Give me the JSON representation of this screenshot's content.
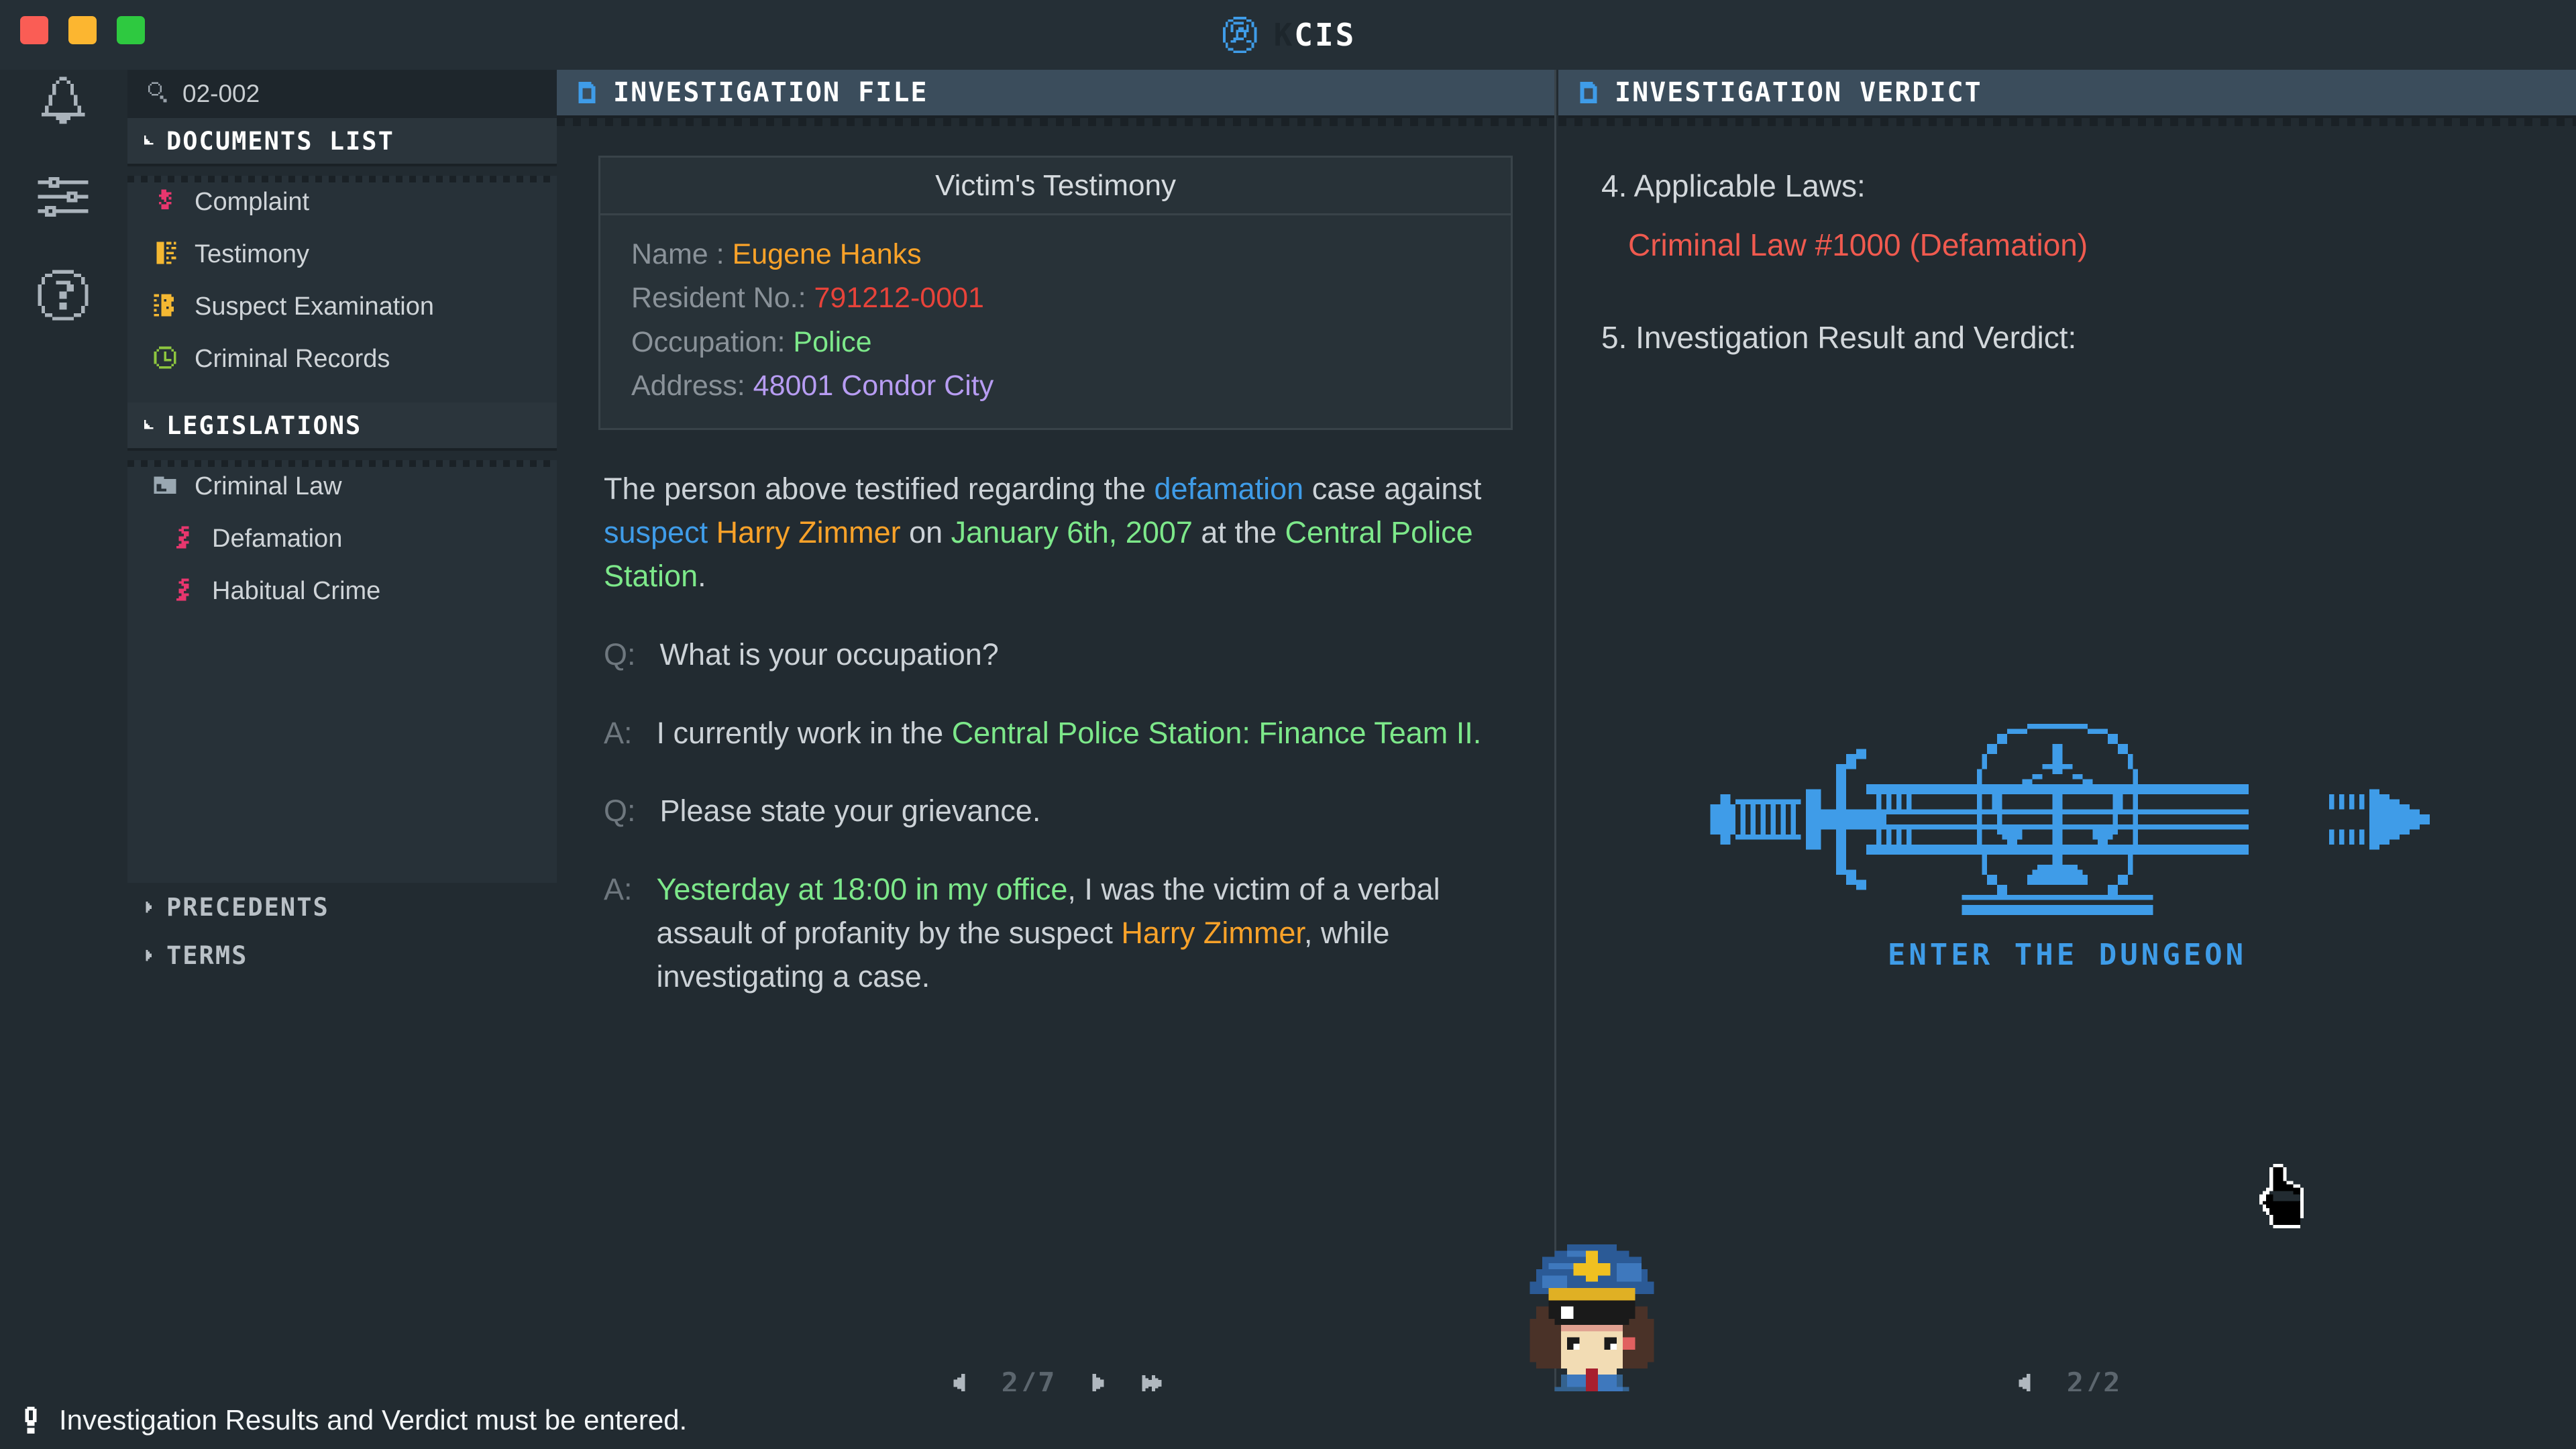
{
  "window": {
    "title": "KCIS",
    "title_prefix": "K",
    "title_rest": "CIS",
    "controls": [
      "close",
      "minimize",
      "maximize"
    ]
  },
  "rail": {
    "items": [
      {
        "name": "notifications",
        "icon": "bell-icon"
      },
      {
        "name": "settings",
        "icon": "sliders-icon"
      },
      {
        "name": "help",
        "icon": "question-circle-icon"
      }
    ]
  },
  "sidebar": {
    "search": {
      "value": "02-002",
      "placeholder": "Search",
      "icon": "search-icon"
    },
    "sections": [
      {
        "label": "DOCUMENTS LIST",
        "expanded": true,
        "items": [
          {
            "label": "Complaint",
            "icon": "complaint-icon",
            "color": "#e8366e"
          },
          {
            "label": "Testimony",
            "icon": "testimony-icon",
            "color": "#f4b832"
          },
          {
            "label": "Suspect Examination",
            "icon": "suspect-icon",
            "color": "#f4b832"
          },
          {
            "label": "Criminal Records",
            "icon": "records-icon",
            "color": "#8ec63f"
          }
        ]
      },
      {
        "label": "LEGISLATIONS",
        "expanded": true,
        "items": [
          {
            "label": "Criminal Law",
            "icon": "folder-icon",
            "color": "#9aa8b2",
            "sub": false
          },
          {
            "label": "Defamation",
            "icon": "section-sign-icon",
            "color": "#e8366e",
            "sub": true
          },
          {
            "label": "Habitual Crime",
            "icon": "section-sign-icon",
            "color": "#e8366e",
            "sub": true
          }
        ]
      },
      {
        "label": "PRECEDENTS",
        "expanded": false,
        "items": []
      },
      {
        "label": "TERMS",
        "expanded": false,
        "items": []
      }
    ]
  },
  "center_panel": {
    "header": {
      "title": "INVESTIGATION FILE",
      "icon": "document-icon"
    },
    "card": {
      "title": "Victim's Testimony",
      "fields": [
        {
          "label": "Name :",
          "value": "Eugene Hanks",
          "value_color": "#f9a229"
        },
        {
          "label": "Resident No.:",
          "value": "791212-0001",
          "value_color": "#e8433a"
        },
        {
          "label": "Occupation:",
          "value": "Police",
          "value_color": "#7de88a"
        },
        {
          "label": "Address:",
          "value": "48001 Condor City",
          "value_color": "#b79cf2"
        }
      ]
    },
    "narrative": {
      "p1": "The person above testified regarding the ",
      "h_defamation": "defamation",
      "p2": " case against ",
      "h_suspect": "suspect",
      "p3": " ",
      "h_harry": "Harry Zimmer",
      "p4": " on ",
      "h_date": "January 6th, 2007",
      "p5": " at the ",
      "h_place": "Central Police Station",
      "p6": "."
    },
    "qa": [
      {
        "label": "Q:",
        "p1": "What is your occupation?"
      },
      {
        "label": "A:",
        "p1": "I currently work in the ",
        "h1": "Central Police Station: Finance Team II.",
        "p2": ""
      },
      {
        "label": "Q:",
        "p1": "Please state your grievance."
      },
      {
        "label": "A:",
        "h1": "Yesterday at 18:00 in my office",
        "p1": ", I was the victim of a verbal assault of profanity by the suspect ",
        "h2": "Harry Zimmer",
        "p2": ", while investigating a case."
      }
    ],
    "pager": {
      "current": "2",
      "total": "7",
      "display": "2/7",
      "first_label": "first",
      "prev_label": "prev",
      "next_label": "next",
      "last_label": "last"
    }
  },
  "right_panel": {
    "header": {
      "title": "INVESTIGATION VERDICT",
      "icon": "document-icon"
    },
    "section4": {
      "heading": "4. Applicable Laws:",
      "law": "Criminal Law #1000 (Defamation)"
    },
    "section5": {
      "heading": "5. Investigation Result and Verdict:",
      "value": ""
    },
    "emblem": {
      "caption": "ENTER THE DUNGEON",
      "icon": "sword-scales-icon",
      "color": "#3f9ce8"
    },
    "pager": {
      "current": "2",
      "total": "2",
      "display": "2/2",
      "prev_label": "prev"
    }
  },
  "officer": {
    "name": "police-officer-sprite"
  },
  "statusbar": {
    "icon": "warning-icon",
    "message": "Investigation Results and Verdict must be entered."
  },
  "cursor": {
    "type": "pointing-hand"
  },
  "colors": {
    "bg": "#222b31",
    "panel_header": "#3b4d5c",
    "accent_blue": "#3f9ce8",
    "accent_green": "#7de88a",
    "accent_orange": "#f9a229",
    "accent_red": "#e8433a",
    "accent_purple": "#b79cf2",
    "accent_pink": "#e8366e"
  }
}
